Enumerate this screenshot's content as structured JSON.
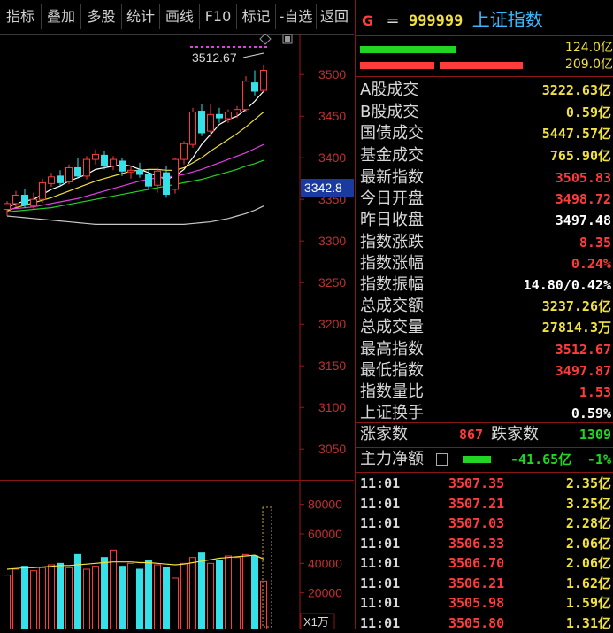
{
  "toolbar": {
    "buttons": [
      "指标",
      "叠加",
      "多股",
      "统计",
      "画线",
      "F10",
      "标记",
      "-自选",
      "返回"
    ]
  },
  "header": {
    "badge": "G",
    "code": "999999",
    "name": "上证指数"
  },
  "ratio_bars": {
    "top_value": "124.0亿",
    "bottom_value": "209.0亿"
  },
  "turnover": [
    {
      "label": "A股成交",
      "value": "3222.63亿",
      "color": "yel"
    },
    {
      "label": "B股成交",
      "value": "0.59亿",
      "color": "yel"
    },
    {
      "label": "国债成交",
      "value": "5447.57亿",
      "color": "yel"
    },
    {
      "label": "基金成交",
      "value": "765.90亿",
      "color": "yel"
    }
  ],
  "stats": [
    {
      "label": "最新指数",
      "value": "3505.83",
      "color": "red"
    },
    {
      "label": "今日开盘",
      "value": "3498.72",
      "color": "red"
    },
    {
      "label": "昨日收盘",
      "value": "3497.48",
      "color": "wht"
    },
    {
      "label": "指数涨跌",
      "value": "8.35",
      "color": "red"
    },
    {
      "label": "指数涨幅",
      "value": "0.24%",
      "color": "red"
    },
    {
      "label": "指数振幅",
      "value": "14.80/0.42%",
      "color": "wht"
    },
    {
      "label": "总成交额",
      "value": "3237.26亿",
      "color": "yel"
    },
    {
      "label": "总成交量",
      "value": "27814.3万",
      "color": "yel"
    },
    {
      "label": "最高指数",
      "value": "3512.67",
      "color": "red"
    },
    {
      "label": "最低指数",
      "value": "3497.87",
      "color": "red"
    },
    {
      "label": "指数量比",
      "value": "1.53",
      "color": "red"
    },
    {
      "label": "上证换手",
      "value": "0.59%",
      "color": "wht"
    }
  ],
  "breadth": {
    "up_label": "涨家数",
    "up_value": "867",
    "down_label": "跌家数",
    "down_value": "1309"
  },
  "capital": {
    "label": "主力净额",
    "value": "-41.65亿",
    "pct": "-1%"
  },
  "ticks": [
    {
      "time": "11:01",
      "price": "3507.35",
      "amount": "2.35亿"
    },
    {
      "time": "11:01",
      "price": "3507.21",
      "amount": "3.25亿"
    },
    {
      "time": "11:01",
      "price": "3507.03",
      "amount": "2.28亿"
    },
    {
      "time": "11:01",
      "price": "3506.33",
      "amount": "2.06亿"
    },
    {
      "time": "11:01",
      "price": "3506.70",
      "amount": "2.06亿"
    },
    {
      "time": "11:01",
      "price": "3506.21",
      "amount": "1.62亿"
    },
    {
      "time": "11:01",
      "price": "3505.98",
      "amount": "1.59亿"
    },
    {
      "time": "11:01",
      "price": "3505.80",
      "amount": "1.31亿"
    }
  ],
  "colors": {
    "up": "#ff3b3b",
    "down": "#36e0e8",
    "accent": "#8a1515",
    "ma5": "#ffffff",
    "ma10": "#f0e040",
    "ma20": "#e040e0",
    "ma30": "#22d522",
    "ma60": "#c8c8c8"
  },
  "chart_data": [
    {
      "type": "candlestick",
      "title": "",
      "y_ticks": [
        3500,
        3450,
        3400,
        3350,
        3300,
        3250,
        3200,
        3150,
        3100,
        3050
      ],
      "ylim": [
        3030,
        3530
      ],
      "price_tag": "3342.8",
      "high_marker": "3512.67",
      "candles": [
        {
          "o": 3338,
          "h": 3348,
          "l": 3330,
          "c": 3345
        },
        {
          "o": 3345,
          "h": 3360,
          "l": 3340,
          "c": 3355
        },
        {
          "o": 3355,
          "h": 3362,
          "l": 3340,
          "c": 3343
        },
        {
          "o": 3342,
          "h": 3358,
          "l": 3338,
          "c": 3350
        },
        {
          "o": 3350,
          "h": 3375,
          "l": 3346,
          "c": 3370
        },
        {
          "o": 3369,
          "h": 3382,
          "l": 3365,
          "c": 3377
        },
        {
          "o": 3378,
          "h": 3385,
          "l": 3366,
          "c": 3370
        },
        {
          "o": 3371,
          "h": 3392,
          "l": 3368,
          "c": 3388
        },
        {
          "o": 3388,
          "h": 3400,
          "l": 3375,
          "c": 3378
        },
        {
          "o": 3378,
          "h": 3402,
          "l": 3374,
          "c": 3398
        },
        {
          "o": 3398,
          "h": 3410,
          "l": 3392,
          "c": 3404
        },
        {
          "o": 3403,
          "h": 3408,
          "l": 3386,
          "c": 3390
        },
        {
          "o": 3390,
          "h": 3402,
          "l": 3385,
          "c": 3398
        },
        {
          "o": 3396,
          "h": 3400,
          "l": 3378,
          "c": 3384
        },
        {
          "o": 3383,
          "h": 3390,
          "l": 3375,
          "c": 3385
        },
        {
          "o": 3385,
          "h": 3394,
          "l": 3376,
          "c": 3380
        },
        {
          "o": 3380,
          "h": 3385,
          "l": 3362,
          "c": 3366
        },
        {
          "o": 3367,
          "h": 3388,
          "l": 3358,
          "c": 3384
        },
        {
          "o": 3382,
          "h": 3390,
          "l": 3352,
          "c": 3356
        },
        {
          "o": 3362,
          "h": 3400,
          "l": 3357,
          "c": 3398
        },
        {
          "o": 3398,
          "h": 3420,
          "l": 3392,
          "c": 3417
        },
        {
          "o": 3416,
          "h": 3460,
          "l": 3412,
          "c": 3455
        },
        {
          "o": 3456,
          "h": 3465,
          "l": 3426,
          "c": 3430
        },
        {
          "o": 3432,
          "h": 3465,
          "l": 3425,
          "c": 3452
        },
        {
          "o": 3452,
          "h": 3460,
          "l": 3442,
          "c": 3448
        },
        {
          "o": 3447,
          "h": 3458,
          "l": 3442,
          "c": 3455
        },
        {
          "o": 3455,
          "h": 3462,
          "l": 3448,
          "c": 3458
        },
        {
          "o": 3458,
          "h": 3498,
          "l": 3455,
          "c": 3492
        },
        {
          "o": 3490,
          "h": 3505,
          "l": 3475,
          "c": 3480
        },
        {
          "o": 3481,
          "h": 3512,
          "l": 3478,
          "c": 3505
        }
      ],
      "ma_lines": [
        {
          "name": "MA5",
          "values": [
            3340,
            3345,
            3348,
            3350,
            3356,
            3362,
            3366,
            3372,
            3376,
            3380,
            3386,
            3388,
            3390,
            3392,
            3390,
            3386,
            3382,
            3378,
            3374,
            3378,
            3386,
            3400,
            3416,
            3428,
            3440,
            3446,
            3450,
            3458,
            3468,
            3480
          ]
        },
        {
          "name": "MA10",
          "values": [
            3336,
            3340,
            3343,
            3346,
            3349,
            3352,
            3356,
            3360,
            3364,
            3368,
            3372,
            3375,
            3378,
            3381,
            3384,
            3385,
            3386,
            3386,
            3385,
            3385,
            3388,
            3394,
            3400,
            3408,
            3415,
            3422,
            3429,
            3437,
            3446,
            3455
          ]
        },
        {
          "name": "MA20",
          "values": [
            3338,
            3339,
            3340,
            3341,
            3343,
            3345,
            3347,
            3349,
            3351,
            3354,
            3357,
            3360,
            3363,
            3366,
            3369,
            3372,
            3374,
            3376,
            3377,
            3378,
            3380,
            3383,
            3386,
            3390,
            3394,
            3398,
            3402,
            3406,
            3411,
            3416
          ]
        },
        {
          "name": "MA30",
          "values": [
            3335,
            3336,
            3337,
            3338,
            3339,
            3340,
            3342,
            3344,
            3346,
            3348,
            3350,
            3352,
            3354,
            3356,
            3358,
            3360,
            3362,
            3364,
            3366,
            3368,
            3370,
            3372,
            3374,
            3377,
            3380,
            3383,
            3386,
            3390,
            3393,
            3397
          ]
        },
        {
          "name": "MA60",
          "values": [
            3330,
            3329,
            3328,
            3327,
            3326,
            3325,
            3324,
            3323,
            3322,
            3321,
            3320,
            3320,
            3320,
            3320,
            3320,
            3320,
            3320,
            3320,
            3320,
            3320,
            3320,
            3321,
            3322,
            3323,
            3325,
            3327,
            3330,
            3333,
            3337,
            3342
          ]
        }
      ]
    },
    {
      "type": "bar",
      "title": "",
      "unit_label": "X1万",
      "y_ticks": [
        80000,
        60000,
        40000,
        20000
      ],
      "ylim": [
        0,
        90000
      ],
      "values": [
        32000,
        36000,
        38000,
        35000,
        37000,
        39000,
        40000,
        37000,
        46000,
        36000,
        38000,
        44000,
        49000,
        38000,
        40000,
        36000,
        42000,
        39000,
        37000,
        30000,
        40000,
        44000,
        47000,
        40000,
        42000,
        45000,
        44000,
        46000,
        45000,
        28000
      ],
      "ma_values": [
        36000,
        36500,
        37000,
        37000,
        37500,
        38000,
        38500,
        38500,
        39000,
        39500,
        40000,
        40500,
        41000,
        41000,
        41000,
        40500,
        40500,
        40000,
        39500,
        39000,
        39500,
        40500,
        41500,
        42500,
        43500,
        44000,
        44500,
        45000,
        45500,
        43000
      ]
    }
  ]
}
